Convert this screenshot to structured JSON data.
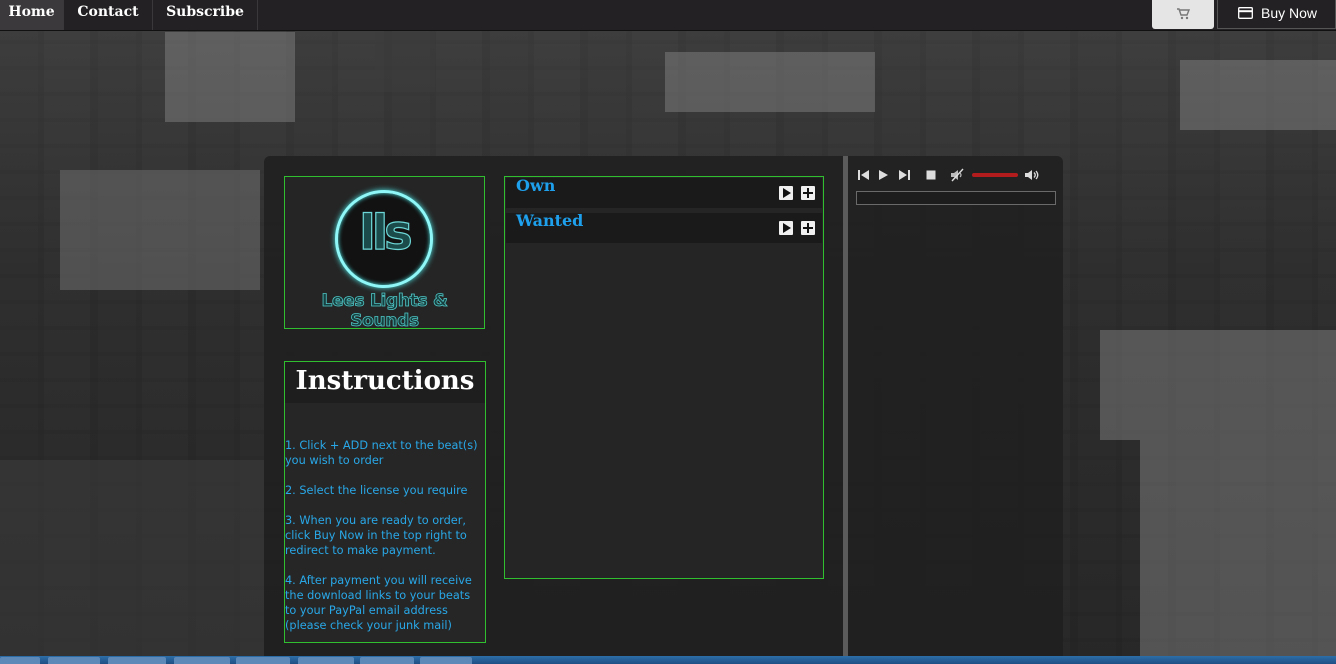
{
  "nav": {
    "items": [
      {
        "label": "Home"
      },
      {
        "label": "Contact"
      },
      {
        "label": "Subscribe"
      }
    ],
    "cart_icon": "cart-icon",
    "buy_now_label": "Buy Now",
    "buy_now_icon": "credit-card-icon"
  },
  "logo": {
    "monogram": "lls",
    "text": "Lees Lights & Sounds"
  },
  "instructions": {
    "title": "Instructions",
    "steps": [
      "1. Click + ADD next to the beat(s) you wish to order",
      "2. Select the license you require",
      "3. When you are ready to order, click Buy Now in the top right to redirect to make payment.",
      "4. After payment you will receive the download links to your beats to your PayPal email address (please check your junk mail)"
    ]
  },
  "tracks": [
    {
      "title": "Own"
    },
    {
      "title": "Wanted"
    }
  ],
  "player": {
    "controls": [
      "previous-icon",
      "play-icon",
      "next-icon",
      "stop-icon",
      "mute-icon",
      "volume-icon"
    ],
    "volume_level": 1.0
  },
  "colors": {
    "accent_blue": "#1ea0ec",
    "border_green": "#2fbf2f",
    "logo_glow": "#8ff7f7",
    "volume_red": "#b21c1c"
  }
}
